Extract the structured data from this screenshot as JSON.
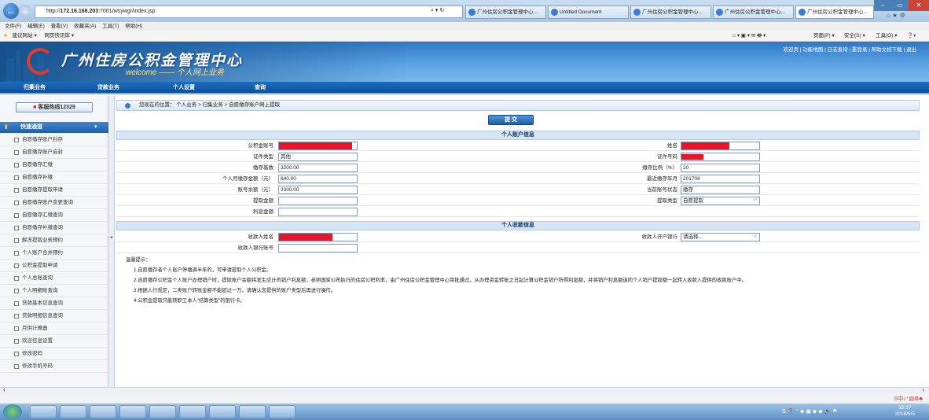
{
  "browser": {
    "url_prefix": "http://",
    "url_host": "172.16.168.203",
    "url_rest": ":7001/wsywgr/index.jsp",
    "tabs": [
      "广州住房公积金管理中心...",
      "Untitled Document",
      "广州住房公积金管理中心...",
      "广州住房公积金管理中心...",
      "广州住房公积金管理中心...",
      "广州住房公积金管理..."
    ],
    "menu": [
      "文件(F)",
      "编辑(E)",
      "查看(V)",
      "收藏夹(A)",
      "工具(T)",
      "帮助(H)"
    ],
    "favorites": [
      "建议网站 ▾",
      "网页快讯库 ▾"
    ],
    "toolbar_right": [
      "页面(P) ▾",
      "安全(S) ▾",
      "工具(O) ▾"
    ]
  },
  "banner": {
    "title": "广州住房公积金管理中心",
    "subtitle": "welcome —— 个人网上业务",
    "links": "欢迎页 | 功能地图 | 日志查询 | 重登录 | 帮助文档下载 | 退出"
  },
  "nav": [
    "归集业务",
    "贷款业务",
    "个人设置",
    "查询"
  ],
  "sidebar": {
    "hotline": "客服热线12329",
    "quick_title": "快速通道",
    "items": [
      "自愿缴存账户封存",
      "自愿缴存账户启封",
      "自愿缴存汇缴",
      "自愿缴存补缴",
      "自愿缴存提取申请",
      "自愿缴存账户变更查询",
      "自愿缴存汇缴查询",
      "自愿缴存补缴查询",
      "解冻提取业务预约",
      "个人账户合并预约",
      "公积金提取申请",
      "个人总账查询",
      "个人明细账查询",
      "贷款基本信息查询",
      "贷款明细信息查询",
      "月供计算器",
      "欢迎信息设置",
      "修改密码",
      "修改手机号码"
    ]
  },
  "breadcrumb": "您现在的位置： 个人业务 > 归集业务 > 自愿缴存账户网上提取",
  "submit_label": "提 交",
  "account_section": {
    "title": "个人账户信息",
    "rows": [
      {
        "l1": "公积金账号",
        "v1": "",
        "l2": "姓名",
        "v2": ""
      },
      {
        "l1": "证件类型",
        "v1": "其他",
        "l2": "证件号码",
        "v2": ""
      },
      {
        "l1": "缴存基数",
        "v1": "3200.00",
        "l2": "缴存比例（%）",
        "v2": "20"
      },
      {
        "l1": "个人月缴存金额（元）",
        "v1": "640.00",
        "l2": "最近缴存年月",
        "v2": "201708"
      },
      {
        "l1": "账号余额（元）",
        "v1": "3300.00",
        "l2": "当前账号状态",
        "v2": "缴存"
      },
      {
        "l1": "提取金额",
        "v1": "",
        "l2": "提取类型",
        "v2": "自愿提取"
      },
      {
        "l1": "利息金额",
        "v1": ""
      }
    ]
  },
  "payee_section": {
    "title": "个人收款信息",
    "rows": [
      {
        "l1": "收款人姓名",
        "v1": "",
        "l2": "收款人开户银行",
        "v2": "请选择..."
      },
      {
        "l1": "收款人银行账号",
        "v1": ""
      }
    ]
  },
  "notes": {
    "title": "温馨提示：",
    "items": [
      "1.自愿缴存者个人账户停缴满半年的，可申请提取个人公积金。",
      "2.自愿缴存公积金个人账户办理销户时，提取账户余额将发生应计的销户利息额，参照国家公布执行的住房公积利率，由广州住房公积金管理中心审批通过，从办理资金转账之日起计算公积金销户所得利息额，并将销户利息额连同个人销户提取额一起转入收款人提供的收款账户中。",
      "3.根据人行规定，二类账户转账金额不能超过一万，请确认您提供的账户类型后再进行操作。",
      "4.公积金提取只能转职工本人“结算类型”的银行卡。"
    ]
  },
  "clock": {
    "time": "15:37",
    "date": "2018/6/5"
  }
}
